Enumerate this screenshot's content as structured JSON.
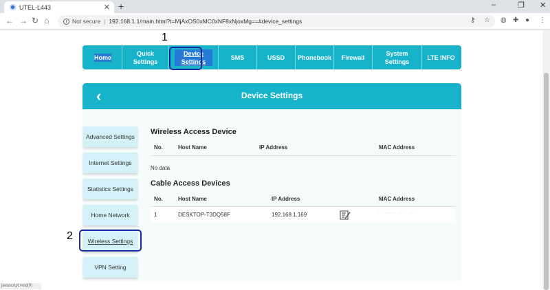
{
  "browser": {
    "tab_title": "UTEL-L443",
    "tab_close": "✕",
    "new_tab": "+",
    "not_secure": "Not secure",
    "url": "192.168.1.1/main.html?t=MjAxOS0xMC0xNF8xNjoxMg==#device_settings",
    "controls": {
      "minimize": "–",
      "restore": "❐",
      "close": "✕"
    }
  },
  "topnav": {
    "items": [
      {
        "label": "Home"
      },
      {
        "label": "Quick Settings"
      },
      {
        "label": "Device Settings"
      },
      {
        "label": "SMS"
      },
      {
        "label": "USSD"
      },
      {
        "label": "Phonebook"
      },
      {
        "label": "Firewall"
      },
      {
        "label": "System Settings"
      },
      {
        "label": "LTE INFO"
      }
    ]
  },
  "annotations": {
    "one": "1",
    "two": "2"
  },
  "header": {
    "back_icon": "‹",
    "title": "Device Settings"
  },
  "sidebar": {
    "items": [
      {
        "label": "Advanced Settings"
      },
      {
        "label": "Internet Settings"
      },
      {
        "label": "Statistics Settings"
      },
      {
        "label": "Home Network"
      },
      {
        "label": "Wireless Settings"
      },
      {
        "label": "VPN Setting"
      }
    ]
  },
  "wireless": {
    "title": "Wireless Access Device",
    "columns": [
      "No.",
      "Host Name",
      "IP Address",
      "MAC Address"
    ],
    "empty": "No data"
  },
  "cable": {
    "title": "Cable Access Devices",
    "columns": [
      "No.",
      "Host Name",
      "IP Address",
      "MAC Address"
    ],
    "rows": [
      {
        "no": "1",
        "host": "DESKTOP-T3DQ58F",
        "ip": "192.168.1.169",
        "mac": "·· ·····  ·· · ··"
      }
    ]
  },
  "status": {
    "text": "javascript:void(0)"
  },
  "colors": {
    "accent": "#16b3cb",
    "sidebar": "#d3f1f6",
    "annotation": "#1a2aa0"
  }
}
